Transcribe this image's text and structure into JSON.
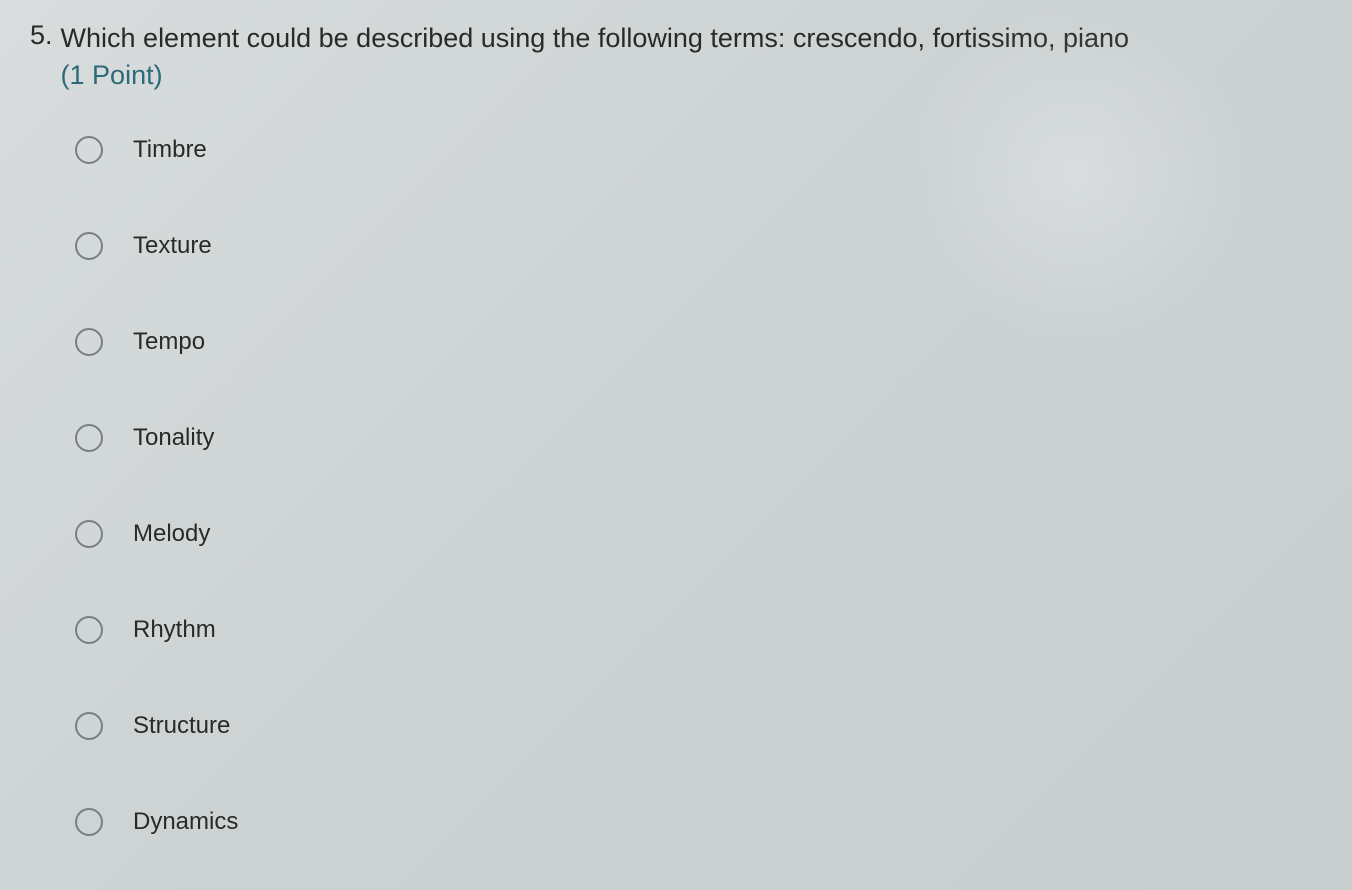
{
  "question": {
    "number": "5.",
    "text": "Which element could be described using the following terms: crescendo, fortissimo, piano",
    "points": "(1 Point)"
  },
  "options": [
    {
      "label": "Timbre"
    },
    {
      "label": "Texture"
    },
    {
      "label": "Tempo"
    },
    {
      "label": "Tonality"
    },
    {
      "label": "Melody"
    },
    {
      "label": "Rhythm"
    },
    {
      "label": "Structure"
    },
    {
      "label": "Dynamics"
    }
  ]
}
